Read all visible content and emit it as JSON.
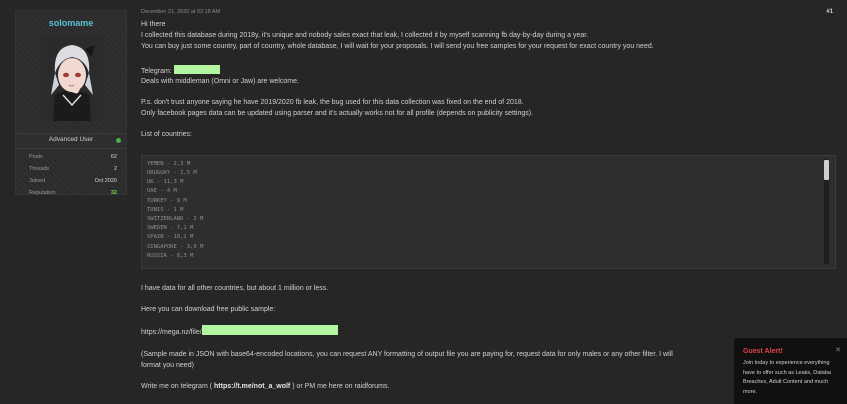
{
  "user": {
    "name": "solomame",
    "rank": "Advanced User",
    "stats": [
      {
        "label": "Posts",
        "value": "62"
      },
      {
        "label": "Threads",
        "value": "2"
      },
      {
        "label": "Joined",
        "value": "Oct 2020"
      },
      {
        "label": "Reputation",
        "value": "32"
      }
    ]
  },
  "post": {
    "date": "December 21, 2020 at 02:18 AM",
    "number": "#1",
    "greeting": "Hi there",
    "intro1": "I collected this database during 2018y, it's unique and nobody sales exact that leak, I collected it by myself scanning fb day-by-day during a year.",
    "intro2": "You can buy just some country, part of country, whole database, I will wait for your proposals. I will send you free samples for your request for exact country you need.",
    "telegram_label": "Telegram:",
    "middleman": "Deals with middleman (Omni or Jaw) are welcome.",
    "ps1": "P.s. don't trust anyone saying he have 2019/2020 fb leak, the bug used for this data collection was fixed on the end of 2018.",
    "ps2": "Only facebook pages data can be updated using parser and it's actually works not for all profile (depends on publicity settings).",
    "list_heading": "List of countries:",
    "countries": [
      "YEMEN - 2,3 M",
      "URUGUAY - 1,5 M",
      "UK - 11,3 M",
      "UAE - 4 M",
      "TURKEY - 9 M",
      "TUNIS - 1 M",
      "SWITZERLAND - 2 M",
      "SWEDEN - 7,1 M",
      "SPAIN - 10,2 M",
      "SINGAPORE - 3,9 M",
      "RUSSIA - 8,3 M"
    ],
    "other": "I have data for all other countries, but about 1 million or less.",
    "download": "Here you can download free public sample:",
    "link": "https://mega.nz/file/",
    "sample1": "(Sample made in JSON with base64-encoded locations, you can request ANY formatting of output file you are paying for, request data for only males or any other filter. I will",
    "sample2": "format you need)",
    "contact_pre": "Write me on telegram (",
    "contact_link": "https://t.me/not_a_wolf",
    "contact_post": ") or PM me here on raidforums."
  },
  "alert": {
    "title": "Guest Alert!",
    "lines": [
      "Join today to experience everything",
      "have to offer such as Leaks, Databa",
      "Breaches, Adult Content and much",
      "more."
    ]
  },
  "colors": {
    "background": "#262626",
    "username": "#58c0d4",
    "reputation": "#7bd44b",
    "redaction": "#b4f5a1",
    "alert_title": "#e04444"
  }
}
